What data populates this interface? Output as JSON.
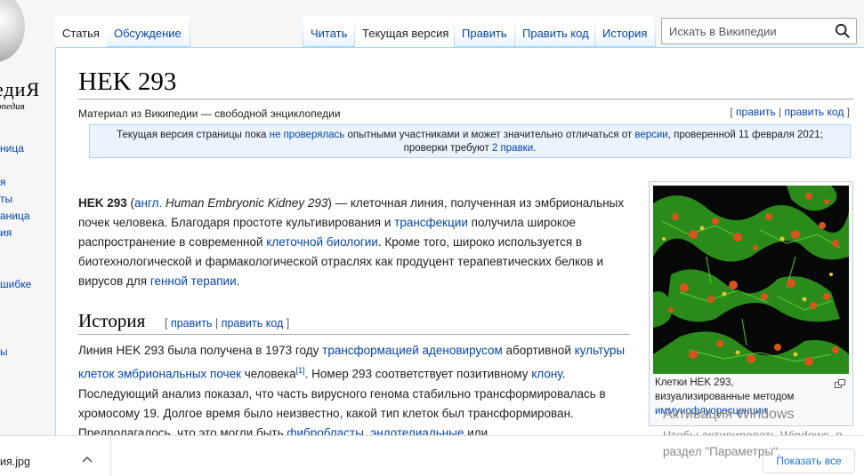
{
  "sidebar": {
    "logo_text": "едиЯ",
    "logo_sub": "опедия",
    "links": [
      "ница",
      "я",
      "ты",
      "аница",
      "ия",
      "шибке",
      "ы"
    ]
  },
  "tabs": {
    "left": [
      "Статья",
      "Обсуждение"
    ],
    "right": [
      "Читать",
      "Текущая версия",
      "Править",
      "Править код",
      "История"
    ]
  },
  "search": {
    "placeholder": "Искать в Википедии"
  },
  "article": {
    "title": "HEK 293",
    "tagline": "Материал из Википедии — свободной энциклопедии",
    "edit_links": {
      "open": "[ ",
      "edit": "править",
      "sep": " | ",
      "edit_code": "править код",
      "close": " ]"
    },
    "notice": {
      "t1": "Текущая версия страницы пока ",
      "l1": "не проверялась",
      "t2": " опытными участниками и может значительно отличаться от ",
      "l2": "версии",
      "t3": ", проверенной 11 февраля 2021;",
      "t4": "проверки требуют ",
      "l3": "2 правки",
      "t5": "."
    },
    "intro": {
      "bold": "HEK 293",
      "t1": " (",
      "l_engl": "англ.",
      "italic": " Human Embryonic Kidney 293",
      "t2": ") — клеточная линия, полученная из эмбриональных почек человека. Благодаря простоте культивирования и ",
      "l_transf": "трансфекции",
      "t3": " получила широкое распространение в современной ",
      "l_cellbio": "клеточной биологии",
      "t4": ". Кроме того, широко используется в биотехнологической и фармакологической отраслях как продуцент терапевтических белков и вирусов для ",
      "l_gene": "генной терапии",
      "t5": "."
    },
    "history": {
      "heading": "История",
      "edit_open": "[ ",
      "edit": "править",
      "sep": " | ",
      "edit_code": "править код",
      "edit_close": " ]",
      "t1": "Линия HEK 293 была получена в 1973 году ",
      "l1": "трансформацией аденовирусом",
      "t2": " абортивной ",
      "l2": "культуры клеток эмбриональных почек",
      "t3": " человека",
      "ref": "[1]",
      "t4": ". Номер 293 соответствует позитивному ",
      "l3": "клону",
      "t5": ". Последующий анализ показал, что часть вирусного генома стабильно трансформировалась в хромосому 19. Долгое время было неизвестно, какой тип клеток был трансформирован. Предполагалось, что это могли быть ",
      "l4": "фибробласты",
      "t6": ", ",
      "l5": "эндотелиальные",
      "t7": " или"
    },
    "thumb": {
      "caption_text": "Клетки HEK 293, визуализированные методом ",
      "caption_link": "иммунофлуоресценции"
    }
  },
  "watermark": {
    "line1": "Активация Windows",
    "line2": "Чтобы активировать Windows, п",
    "line3": "раздел \"Параметры\"."
  },
  "download_bar": {
    "file_name": "ия.jpg",
    "show_all": "Показать все"
  },
  "colors": {
    "link": "#0645ad",
    "tab_border": "#a7d7f9",
    "notice_bg": "#eaf3ff"
  }
}
